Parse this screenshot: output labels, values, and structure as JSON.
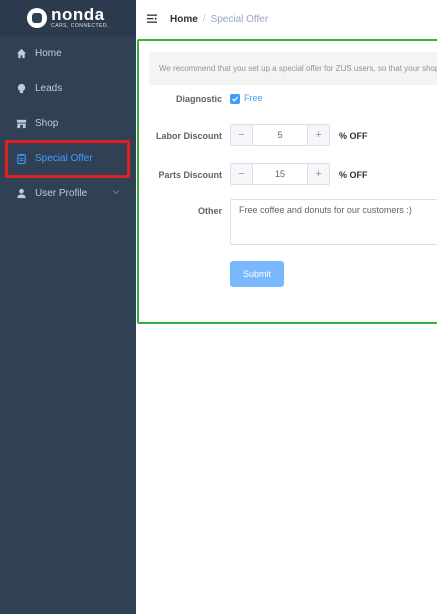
{
  "brand": {
    "name": "nonda",
    "tagline": "CARS, CONNECTED."
  },
  "sidebar": {
    "items": [
      {
        "label": "Home",
        "icon": "house-icon"
      },
      {
        "label": "Leads",
        "icon": "lightbulb-icon"
      },
      {
        "label": "Shop",
        "icon": "shop-icon"
      },
      {
        "label": "Special Offer",
        "icon": "clipboard-icon",
        "active": true
      },
      {
        "label": "User Profile",
        "icon": "user-icon",
        "expandable": true
      }
    ]
  },
  "breadcrumb": {
    "home": "Home",
    "separator": "/",
    "current": "Special Offer"
  },
  "form": {
    "notice": "We recommend that you set up a special offer for ZUS users, so that your shop",
    "diagnostic": {
      "label": "Diagnostic",
      "option": "Free",
      "checked": true
    },
    "labor_discount": {
      "label": "Labor Discount",
      "value": "5",
      "unit": "% OFF"
    },
    "parts_discount": {
      "label": "Parts Discount",
      "value": "15",
      "unit": "% OFF"
    },
    "other": {
      "label": "Other",
      "value": "Free coffee and donuts for our customers :)"
    },
    "submit_label": "Submit"
  },
  "colors": {
    "sidebar_bg": "#304156",
    "active": "#409eff",
    "highlight": "#e01f1f",
    "panel_border": "#3cae3c",
    "submit_bg": "#79b8ff"
  }
}
